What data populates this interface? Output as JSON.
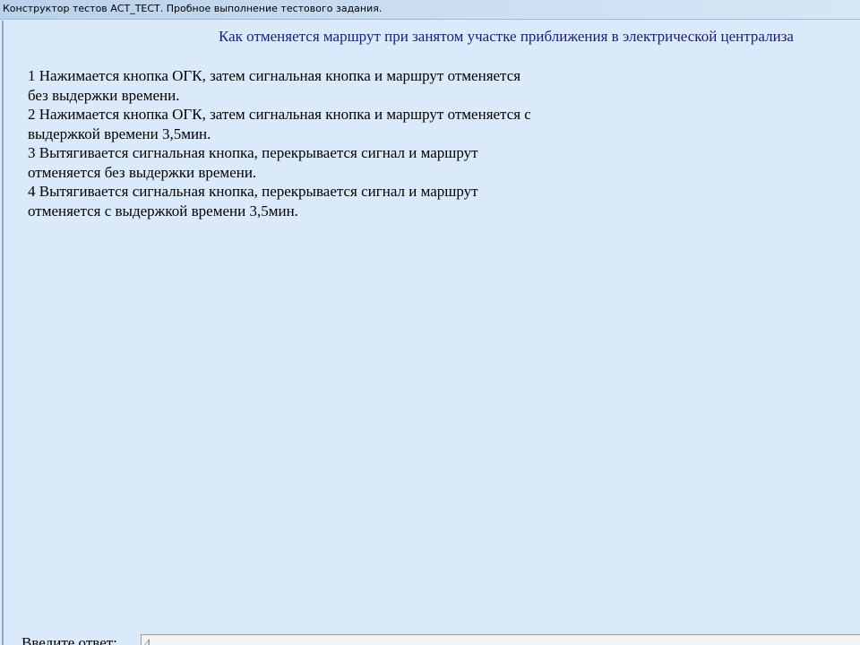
{
  "window": {
    "title": "Конструктор тестов АСТ_ТЕСТ. Пробное выполнение тестового задания."
  },
  "question": {
    "text": "Как отменяется маршрут при занятом участке приближения в электрической централиза"
  },
  "answers": [
    {
      "line1": "1 Нажимается кнопка ОГК, затем сигнальная кнопка и маршрут отменяется",
      "line2": "без выдержки времени."
    },
    {
      "line1": "2 Нажимается кнопка ОГК, затем сигнальная кнопка и маршрут отменяется с",
      "line2": "выдержкой времени 3,5мин."
    },
    {
      "line1": "3 Вытягивается сигнальная кнопка, перекрывается сигнал и маршрут",
      "line2": "отменяется без выдержки времени."
    },
    {
      "line1": "4 Вытягивается сигнальная кнопка, перекрывается сигнал и маршрут",
      "line2": "отменяется с выдержкой времени 3,5мин."
    }
  ],
  "answer_field": {
    "label": "Введите ответ:",
    "value": "4"
  },
  "colors": {
    "background": "#dbeafb",
    "question_text": "#1c1c7a",
    "answer_text": "#000000"
  }
}
